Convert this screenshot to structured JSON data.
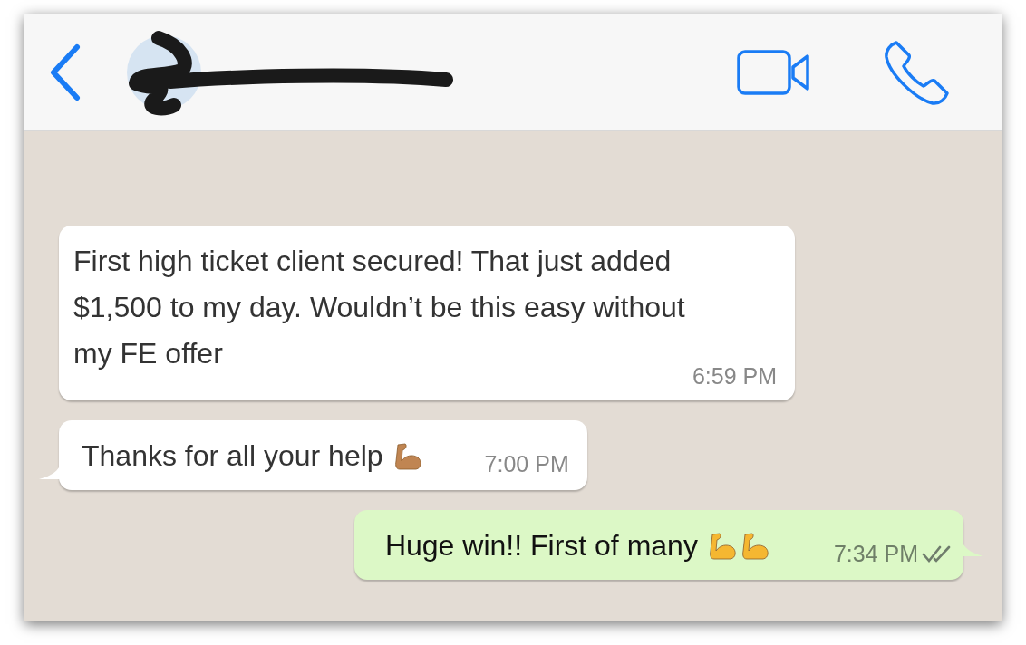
{
  "messages": [
    {
      "outgoing": false,
      "text": "First high ticket client secured! That just added $1,500 to my day. Wouldn’t be this easy without my FE offer",
      "time": "6:59 PM",
      "tail": false
    },
    {
      "outgoing": false,
      "text": "Thanks for all your help",
      "emojis": [
        {
          "color": "#c08552"
        }
      ],
      "time": "7:00 PM",
      "tail": true
    },
    {
      "outgoing": true,
      "text": "Huge win!! First of many",
      "emojis": [
        {
          "color": "#f5b731"
        },
        {
          "color": "#f5b731"
        }
      ],
      "time": "7:34 PM",
      "read": false,
      "tail": true
    }
  ]
}
